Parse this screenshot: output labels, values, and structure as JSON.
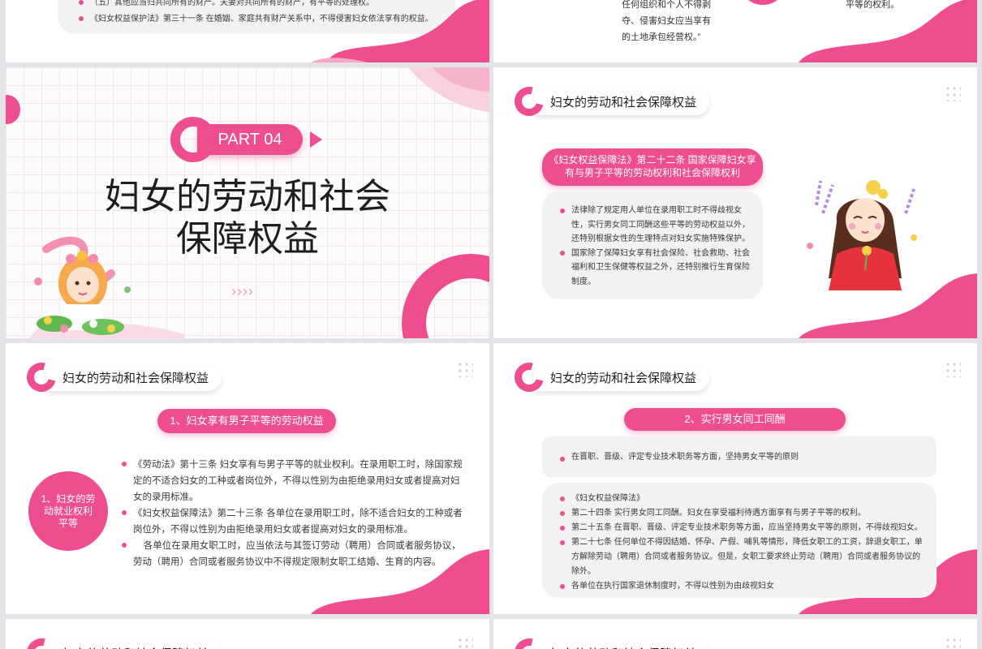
{
  "colors": {
    "accent": "#ee4d8f",
    "bubble": "#f2f2f2",
    "bg": "#e4e4e8"
  },
  "slide1": {
    "line1": "（五）其他应当归共同所有的财产。夫妻对共同所有的财产，有平等的处理权。",
    "line2": "《妇女权益保护法》第三十一条 在婚姻、家庭共有财产关系中，不得侵害妇女依法享有的权益。"
  },
  "slide2": {
    "lines": [
      "任何组织和个人不得剥",
      "夺、侵害妇女应当享有",
      "的土地承包经营权。”"
    ],
    "right_text": "平等的权利。"
  },
  "slide3": {
    "part_label": "PART 04",
    "title_line1": "妇女的劳动和社会",
    "title_line2": "保障权益",
    "arrows": "››››"
  },
  "slide4": {
    "header": "妇女的劳动和社会保障权益",
    "pill_text": "《妇女权益保障法》第二十二条  国家保障妇女享有与男子平等的劳动权利和社会保障权利",
    "bullets": [
      "法律除了规定用人单位在录用职工时不得歧视女性，实行男女同工同酬这些平等的劳动权益以外，还特别根据女性的生理特点对妇女实施特殊保护。",
      "国家除了保障妇女享有社会保险、社会救助、社会福利和卫生保健等权益之外，还特别推行生育保险制度。"
    ]
  },
  "slide5": {
    "header": "妇女的劳动和社会保障权益",
    "pill_title": "1、妇女享有男子平等的劳动权益",
    "circle_text": "1、妇女的劳动就业权利平等",
    "bullets": [
      "《劳动法》第十三条 妇女享有与男子平等的就业权利。在录用职工时，除国家规定的不适合妇女的工种或者岗位外，不得以性别为由拒绝录用妇女或者提高对妇女的录用标准。",
      "《妇女权益保障法》第二十三条 各单位在录用职工时，除不适合妇女的工种或者岗位外，不得以性别为由拒绝录用妇女或者提高对妇女的录用标准。",
      "    各单位在录用女职工时，应当依法与其签订劳动（聘用）合同或者服务协议，劳动（聘用）合同或者服务协议中不得规定限制女职工结婚、生育的内容。"
    ]
  },
  "slide6": {
    "header": "妇女的劳动和社会保障权益",
    "pill_title": "2、实行男女同工同酬",
    "top_bullet": "在晋职、晋级、评定专业技术职务等方面，坚持男女平等的原则",
    "bullets": [
      "《妇女权益保障法》",
      "第二十四条 实行男女同工同酬。妇女在享受福利待遇方面享有与男子平等的权利。",
      "第二十五条 在晋职、晋级、评定专业技术职务等方面，应当坚持男女平等的原则，不得歧视妇女。",
      "第二十七条 任何单位不得因结婚、怀孕、产假、哺乳等情形，降低女职工的工资，辞退女职工，单方解除劳动（聘用）合同或者服务协议。但是，女职工要求终止劳动（聘用）合同或者服务协议的除外。",
      "各单位在执行国家退休制度时，不得以性别为由歧视妇女"
    ]
  },
  "slide7": {
    "header": "妇女的劳动和社会保障权益"
  },
  "slide8": {
    "header": "妇女的劳动和社会保障权益"
  }
}
